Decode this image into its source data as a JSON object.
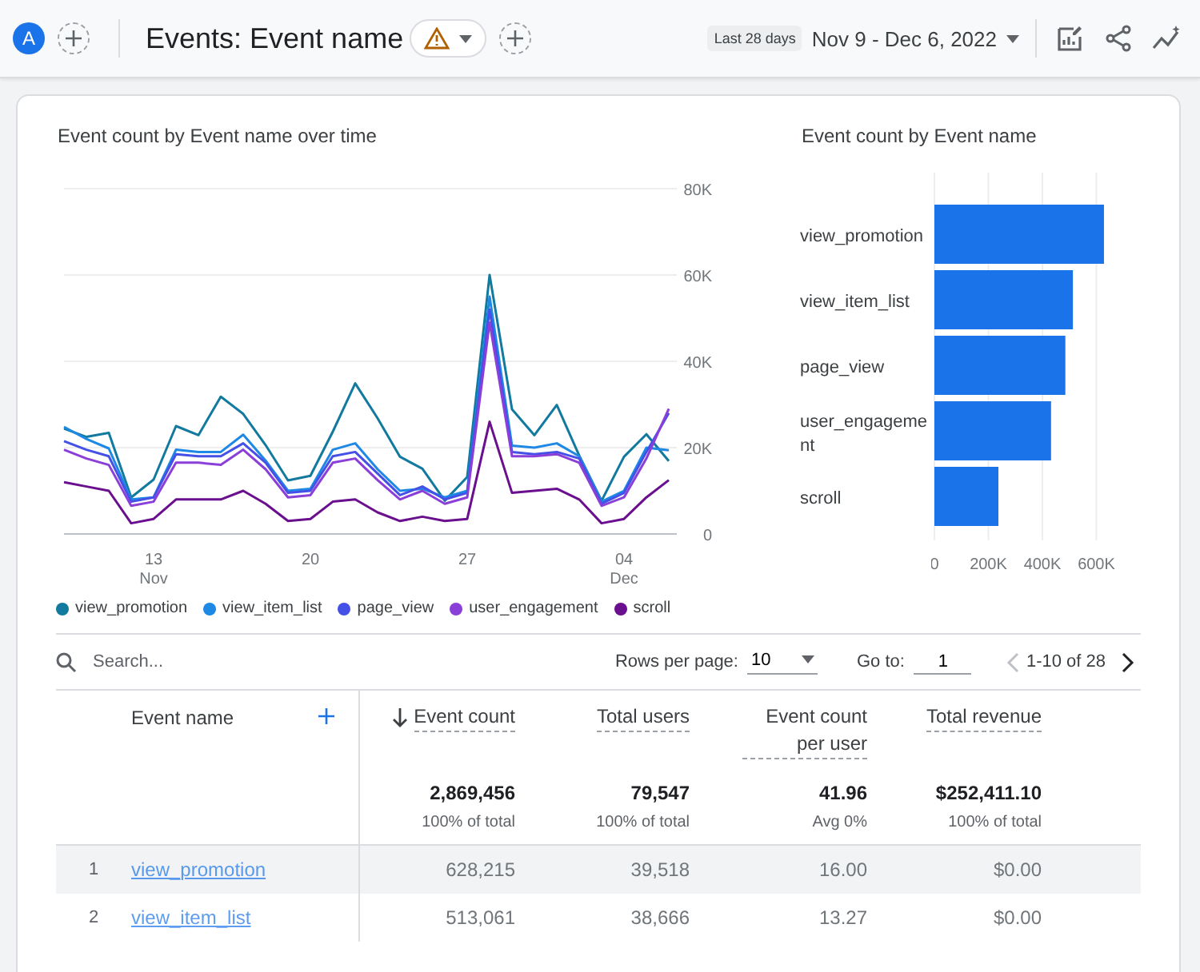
{
  "header": {
    "avatar": "A",
    "title": "Events: Event name",
    "date_chip": "Last 28 days",
    "date_range": "Nov 9 - Dec 6, 2022"
  },
  "line_chart": {
    "title": "Event count by Event name over time",
    "chart_data": {
      "type": "line",
      "categories": [
        null,
        null,
        null,
        null,
        "13 Nov",
        null,
        null,
        null,
        null,
        null,
        null,
        "20",
        null,
        null,
        null,
        null,
        null,
        null,
        "27",
        null,
        null,
        null,
        null,
        null,
        null,
        "04 Dec",
        null,
        null
      ],
      "grid": true,
      "ylim": [
        0,
        80000
      ],
      "yticks": [
        {
          "value": 0,
          "label": "0"
        },
        {
          "value": 20000,
          "label": "20K"
        },
        {
          "value": 40000,
          "label": "40K"
        },
        {
          "value": 60000,
          "label": "60K"
        },
        {
          "value": 80000,
          "label": "80K"
        }
      ],
      "series": [
        {
          "name": "view_promotion",
          "color": "#12799f",
          "values": [
            24400,
            22500,
            23400,
            8500,
            12600,
            25000,
            22900,
            31800,
            27800,
            20600,
            12400,
            13500,
            23700,
            34900,
            26800,
            17900,
            15100,
            7700,
            13200,
            60000,
            28900,
            22900,
            29900,
            18200,
            7700,
            17900,
            23100,
            16900
          ]
        },
        {
          "name": "view_item_list",
          "color": "#1e88e5",
          "values": [
            24800,
            22000,
            19800,
            8000,
            8500,
            19500,
            19000,
            19000,
            23000,
            17000,
            10000,
            10500,
            19500,
            21000,
            15000,
            10000,
            10500,
            8500,
            10000,
            55000,
            20500,
            20000,
            21000,
            18000,
            7500,
            10000,
            20000,
            19400
          ]
        },
        {
          "name": "page_view",
          "color": "#4550e6",
          "values": [
            21500,
            19500,
            18000,
            7500,
            8500,
            18500,
            18000,
            18000,
            21000,
            16500,
            9500,
            10000,
            18000,
            19000,
            14000,
            9000,
            11000,
            8000,
            9500,
            52000,
            19000,
            18500,
            19000,
            17500,
            7000,
            9500,
            19000,
            28000
          ]
        },
        {
          "name": "user_engagement",
          "color": "#8b3fd9",
          "values": [
            19500,
            17500,
            16000,
            6500,
            7500,
            16500,
            16500,
            16000,
            19500,
            15000,
            8500,
            9000,
            16500,
            17500,
            12500,
            8000,
            10000,
            7000,
            8500,
            49000,
            18000,
            18000,
            18500,
            16500,
            6500,
            8500,
            17500,
            29000
          ]
        },
        {
          "name": "scroll",
          "color": "#6a0f8e",
          "values": [
            12000,
            11000,
            10000,
            2500,
            3500,
            8000,
            8000,
            8000,
            10000,
            7000,
            3000,
            3500,
            7500,
            8000,
            5000,
            3000,
            4000,
            3000,
            3500,
            26000,
            9500,
            10000,
            10500,
            8000,
            2500,
            3500,
            8500,
            12500
          ]
        }
      ]
    }
  },
  "bar_chart": {
    "title": "Event count by Event name",
    "chart_data": {
      "type": "bar",
      "orientation": "horizontal",
      "categories": [
        "view_promotion",
        "view_item_list",
        "page_view",
        "user_engagement",
        "scroll"
      ],
      "values": [
        628000,
        513000,
        485000,
        432000,
        237000
      ],
      "grid": true,
      "xlim": [
        0,
        640000
      ],
      "xticks": [
        {
          "value": 0,
          "label": "0"
        },
        {
          "value": 200000,
          "label": "200K"
        },
        {
          "value": 400000,
          "label": "400K"
        },
        {
          "value": 600000,
          "label": "600K"
        }
      ]
    }
  },
  "table_toolbar": {
    "search_placeholder": "Search...",
    "rows_per_page_label": "Rows per page:",
    "rows_per_page": "10",
    "goto_label": "Go to:",
    "goto_value": "1",
    "pager": "1-10 of 28",
    "prev_disabled": true,
    "next_disabled": false
  },
  "table": {
    "first_column": "Event name",
    "columns": [
      {
        "label": "Event count",
        "sorted": true
      },
      {
        "label": "Total users",
        "sorted": false
      },
      {
        "label": "Event count per user",
        "sorted": false
      },
      {
        "label": "Total revenue",
        "sorted": false
      }
    ],
    "totals": [
      {
        "value": "2,869,456",
        "note": "100% of total"
      },
      {
        "value": "79,547",
        "note": "100% of total"
      },
      {
        "value": "41.96",
        "note": "Avg 0%"
      },
      {
        "value": "$252,411.10",
        "note": "100% of total"
      }
    ],
    "rows": [
      {
        "index": "1",
        "name": "view_promotion",
        "cells": [
          "628,215",
          "39,518",
          "16.00",
          "$0.00"
        ],
        "shaded": true
      },
      {
        "index": "2",
        "name": "view_item_list",
        "cells": [
          "513,061",
          "38,666",
          "13.27",
          "$0.00"
        ],
        "shaded": false
      }
    ]
  }
}
